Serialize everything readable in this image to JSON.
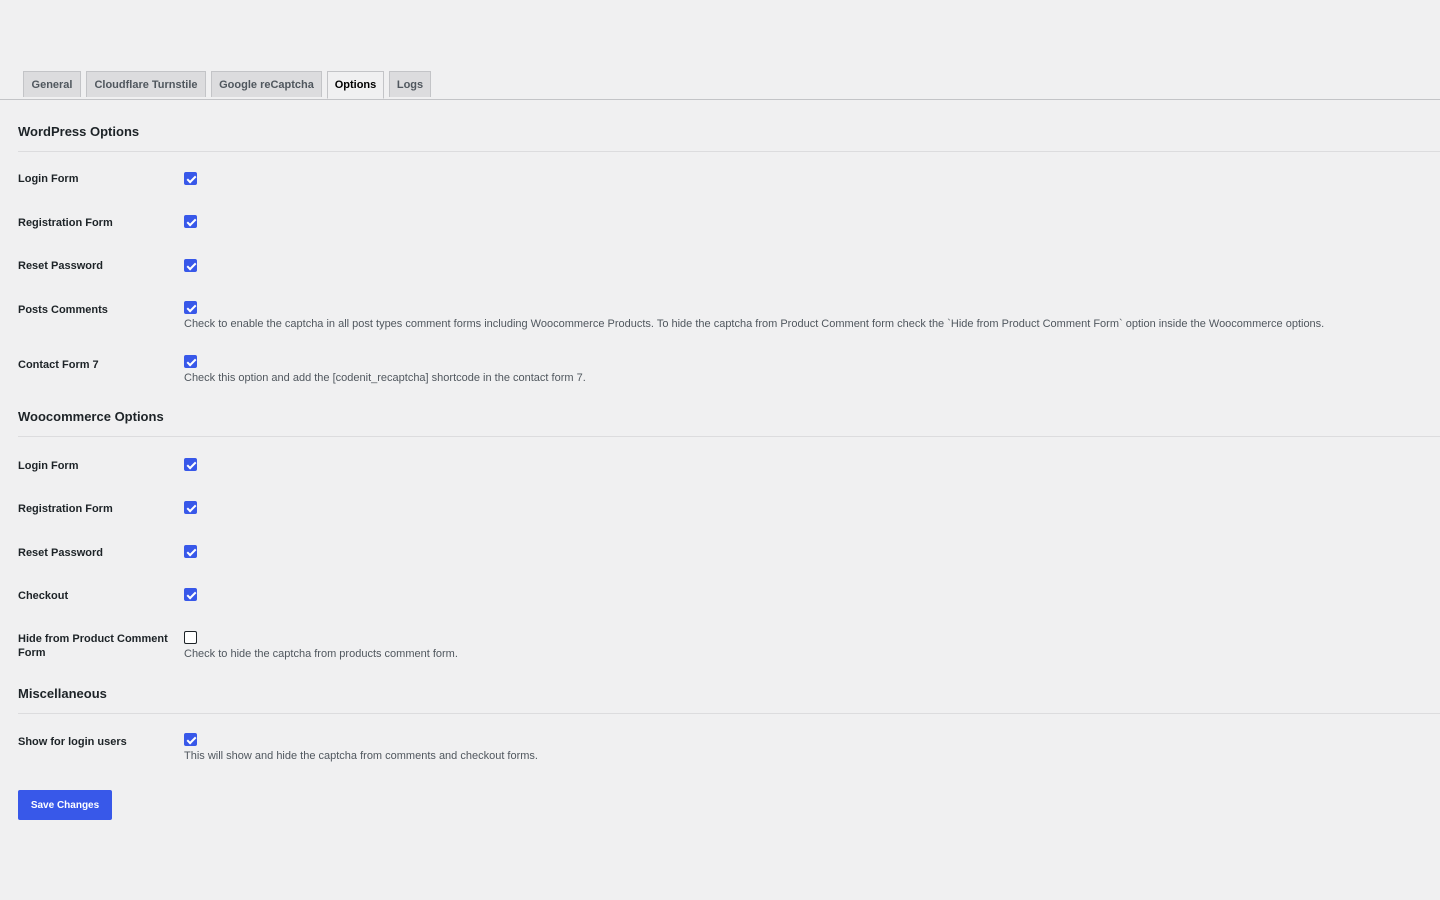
{
  "tabs": [
    {
      "label": "General"
    },
    {
      "label": "Cloudflare Turnstile"
    },
    {
      "label": "Google reCaptcha"
    },
    {
      "label": "Options"
    },
    {
      "label": "Logs"
    }
  ],
  "active_tab": "Options",
  "sections": {
    "wordpress": {
      "title": "WordPress Options",
      "rows": [
        {
          "label": "Login Form",
          "checked": true
        },
        {
          "label": "Registration Form",
          "checked": true
        },
        {
          "label": "Reset Password",
          "checked": true
        },
        {
          "label": "Posts Comments",
          "checked": true,
          "description": "Check to enable the captcha in all post types comment forms including Woocommerce Products. To hide the captcha from Product Comment form check the `Hide from Product Comment Form` option inside the Woocommerce options."
        },
        {
          "label": "Contact Form 7",
          "checked": true,
          "description": "Check this option and add the [codenit_recaptcha] shortcode in the contact form 7."
        }
      ]
    },
    "woocommerce": {
      "title": "Woocommerce Options",
      "rows": [
        {
          "label": "Login Form",
          "checked": true
        },
        {
          "label": "Registration Form",
          "checked": true
        },
        {
          "label": "Reset Password",
          "checked": true
        },
        {
          "label": "Checkout",
          "checked": true
        },
        {
          "label": "Hide from Product Comment Form",
          "checked": false,
          "description": "Check to hide the captcha from products comment form."
        }
      ]
    },
    "misc": {
      "title": "Miscellaneous",
      "rows": [
        {
          "label": "Show for login users",
          "checked": true,
          "description": "This will show and hide the captcha from comments and checkout forms."
        }
      ]
    }
  },
  "save_button": {
    "label": "Save Changes"
  },
  "colors": {
    "accent": "#3858e9",
    "background": "#f0f0f1"
  }
}
